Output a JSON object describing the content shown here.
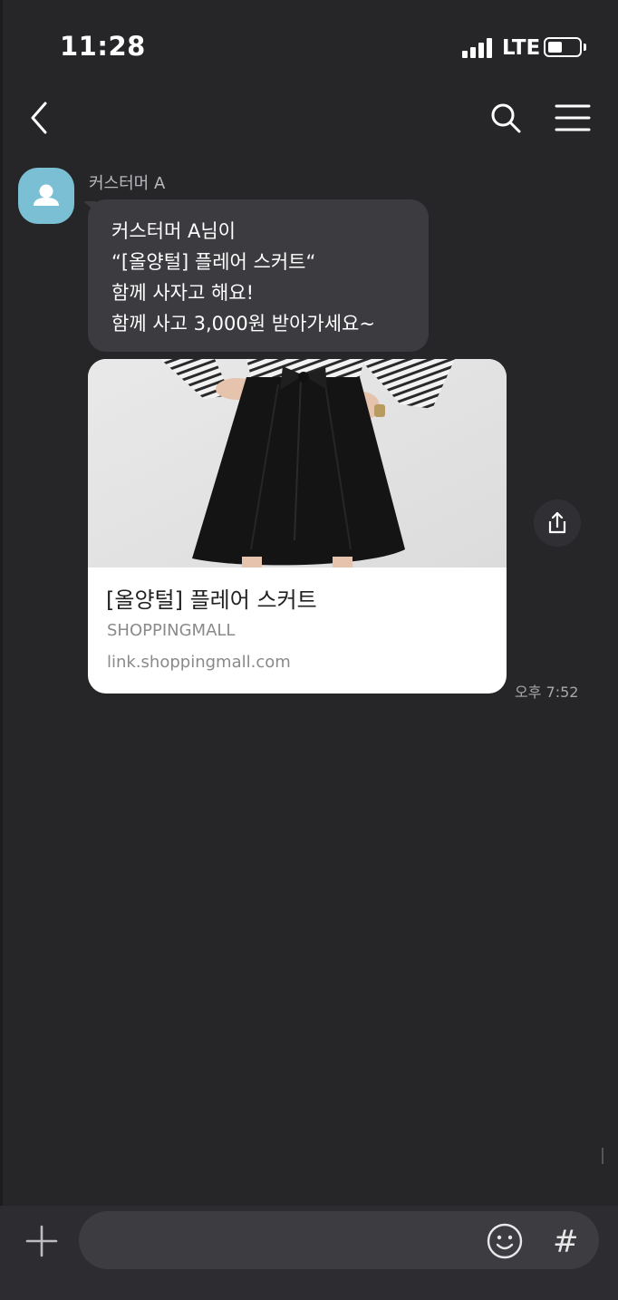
{
  "status_bar": {
    "time": "11:28",
    "network": "LTE",
    "battery_level": 0.45
  },
  "header": {
    "back_icon": "chevron-left-icon",
    "search_icon": "search-icon",
    "menu_icon": "hamburger-menu-icon"
  },
  "chat": {
    "sender_name": "커스터머 A",
    "avatar_icon": "person-icon",
    "avatar_color": "#7bbfd4",
    "message_lines": [
      "커스터머 A님이",
      "“[올양털] 플레어 스커트“",
      "함께 사자고 해요!",
      "함께 사고 3,000원 받아가세요~"
    ],
    "link_card": {
      "title": "[올양털] 플레어 스커트",
      "source": "SHOPPINGMALL",
      "url": "link.shoppingmall.com"
    },
    "share_icon": "share-icon",
    "time": "오후 7:52"
  },
  "input_bar": {
    "plus_icon": "plus-icon",
    "value": "",
    "placeholder": "",
    "emoji_icon": "emoji-icon",
    "hashtag_label": "#"
  },
  "colors": {
    "background": "#262629",
    "bubble": "#3c3c40",
    "card": "#ffffff",
    "input_bar": "#2d2d31"
  }
}
